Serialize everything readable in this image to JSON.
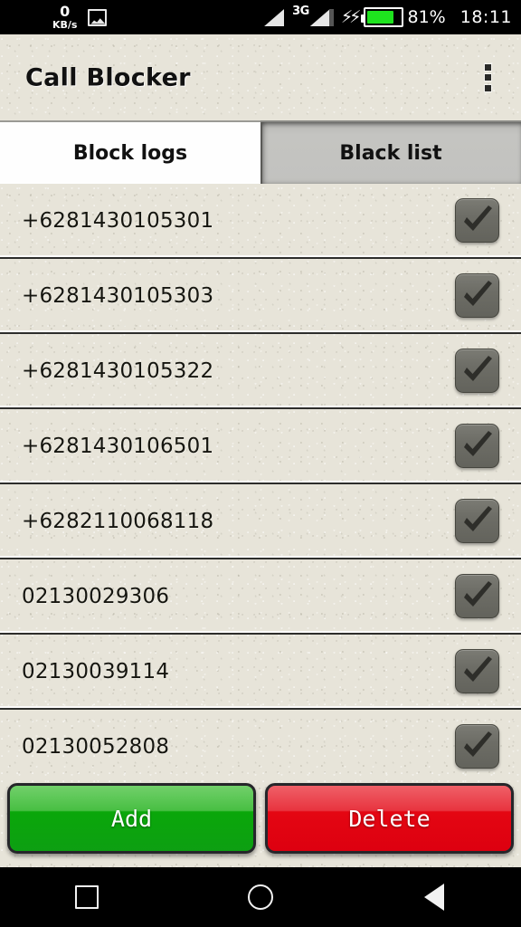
{
  "status_bar": {
    "net_speed_value": "0",
    "net_speed_unit": "KB/s",
    "image_icon": "image-icon",
    "network_type": "3G",
    "charging_icon": "charging-bolt-icon",
    "battery_percent": "81%",
    "battery_level": 81,
    "time": "18:11"
  },
  "app_bar": {
    "title": "Call Blocker",
    "overflow_icon": "overflow-menu-icon"
  },
  "tabs": [
    {
      "label": "Block logs",
      "active": true
    },
    {
      "label": "Black list",
      "active": false
    }
  ],
  "list": {
    "rows": [
      {
        "number": "+6281430105301",
        "checked": true
      },
      {
        "number": "+6281430105303",
        "checked": true
      },
      {
        "number": "+6281430105322",
        "checked": true
      },
      {
        "number": "+6281430106501",
        "checked": true
      },
      {
        "number": "+6282110068118",
        "checked": true
      },
      {
        "number": "02130029306",
        "checked": true
      },
      {
        "number": "02130039114",
        "checked": true
      },
      {
        "number": "02130052808",
        "checked": true
      }
    ]
  },
  "buttons": {
    "add_label": "Add",
    "delete_label": "Delete"
  },
  "nav_bar": {
    "recents": "square-recents-icon",
    "home": "circle-home-icon",
    "back": "triangle-back-icon"
  },
  "colors": {
    "paper": "#e7e4d9",
    "add_green": "#0aa70a",
    "delete_red": "#e40612",
    "battery_green": "#1ee31e",
    "checkbox_gray": "#6d6d66"
  }
}
